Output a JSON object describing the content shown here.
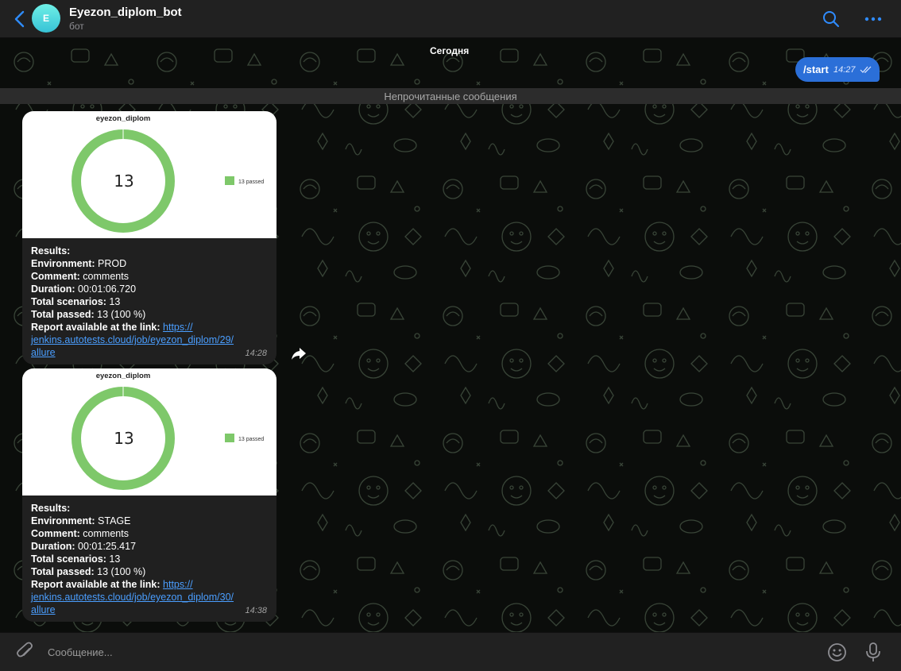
{
  "header": {
    "avatar_letter": "E",
    "title": "Eyezon_diplom_bot",
    "subtitle": "бот",
    "icons": [
      "back-icon",
      "search-icon",
      "more-icon"
    ]
  },
  "chat": {
    "date_label": "Сегодня",
    "outgoing": {
      "text": "/start",
      "time": "14:27"
    },
    "unread_label": "Непрочитанные сообщения",
    "messages": [
      {
        "chart": {
          "title": "eyezon_diplom",
          "center_value": "13",
          "legend": "13 passed",
          "color": "#7ec86a"
        },
        "results_label": "Results:",
        "environment_label": "Environment:",
        "environment": "PROD",
        "comment_label": "Comment:",
        "comment": "comments",
        "duration_label": "Duration:",
        "duration": "00:01:06.720",
        "scenarios_label": "Total scenarios:",
        "scenarios": "13",
        "passed_label": "Total passed:",
        "passed": "13 (100 %)",
        "report_label": "Report available at the link:",
        "link_1": "https://",
        "link_2": "jenkins.autotests.cloud/job/eyezon_diplom/29/",
        "link_3": "allure",
        "time": "14:28"
      },
      {
        "chart": {
          "title": "eyezon_diplom",
          "center_value": "13",
          "legend": "13 passed",
          "color": "#7ec86a"
        },
        "results_label": "Results:",
        "environment_label": "Environment:",
        "environment": "STAGE",
        "comment_label": "Comment:",
        "comment": "comments",
        "duration_label": "Duration:",
        "duration": "00:01:25.417",
        "scenarios_label": "Total scenarios:",
        "scenarios": "13",
        "passed_label": "Total passed:",
        "passed": "13 (100 %)",
        "report_label": "Report available at the link:",
        "link_1": "https://",
        "link_2": "jenkins.autotests.cloud/job/eyezon_diplom/30/",
        "link_3": "allure",
        "time": "14:38"
      }
    ]
  },
  "input": {
    "placeholder": "Сообщение..."
  },
  "colors": {
    "accent": "#2b6fd8",
    "link": "#4a9eff",
    "chart_green": "#7ec86a"
  }
}
